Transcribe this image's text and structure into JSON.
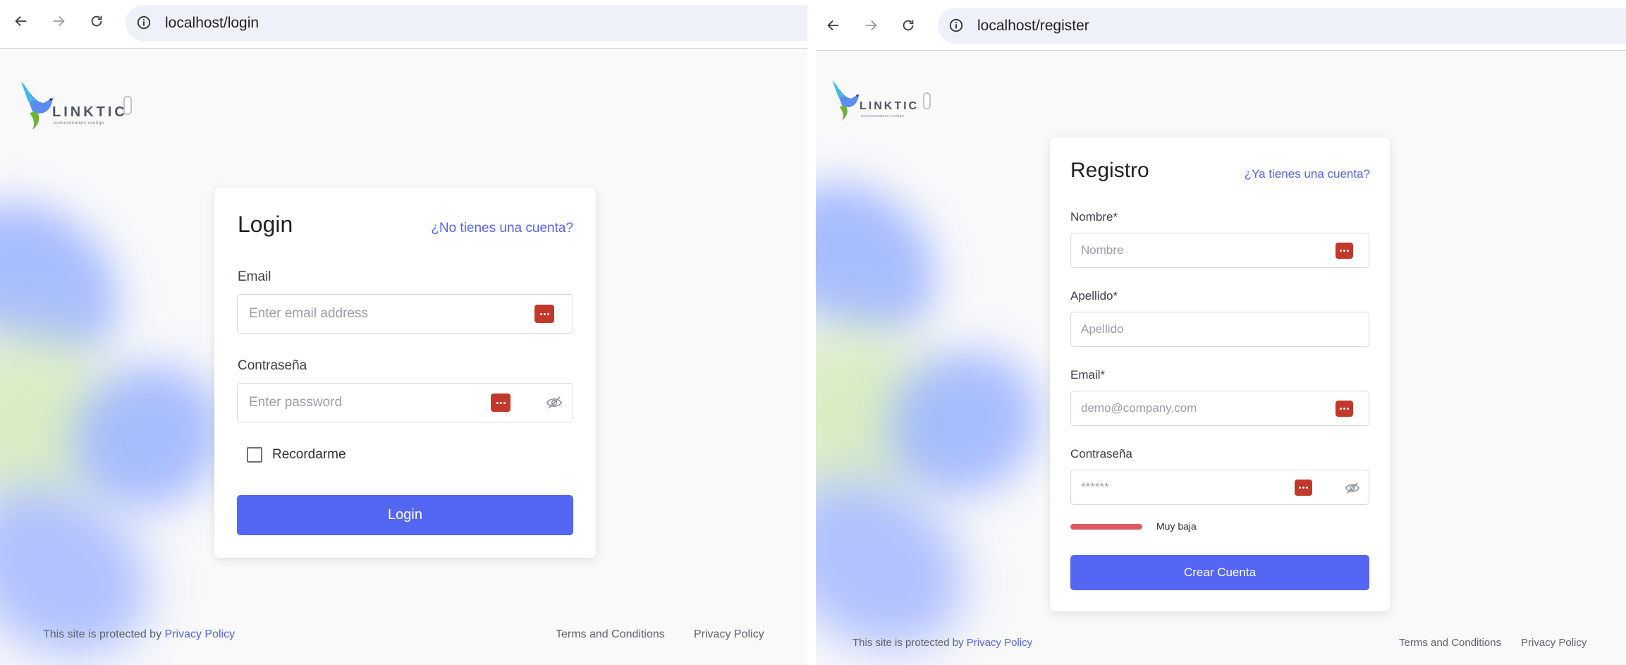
{
  "left": {
    "url": "localhost/login",
    "brand": {
      "name": "LINKTIC",
      "tagline": "evolucionamos contigo"
    },
    "card": {
      "title": "Login",
      "alt_link": "¿No tienes una cuenta?",
      "email_label": "Email",
      "email_placeholder": "Enter email address",
      "password_label": "Contraseña",
      "password_placeholder": "Enter password",
      "remember_label": "Recordarme",
      "submit_label": "Login"
    },
    "footer": {
      "protected_text": "This site is protected by",
      "protected_link": "Privacy Policy",
      "terms": "Terms and Conditions",
      "privacy": "Privacy Policy"
    }
  },
  "right": {
    "url": "localhost/register",
    "brand": {
      "name": "LINKTIC",
      "tagline": "evolucionamos contigo"
    },
    "card": {
      "title": "Registro",
      "alt_link": "¿Ya tienes una cuenta?",
      "name_label": "Nombre*",
      "name_placeholder": "Nombre",
      "lastname_label": "Apellido*",
      "lastname_placeholder": "Apellido",
      "email_label": "Email*",
      "email_placeholder": "demo@company.com",
      "password_label": "Contraseña",
      "password_placeholder": "******",
      "strength_label": "Muy baja",
      "strength_fraction": 1.0,
      "submit_label": "Crear Cuenta"
    },
    "footer": {
      "protected_text": "This site is protected by",
      "protected_link": "Privacy Policy",
      "terms": "Terms and Conditions",
      "privacy": "Privacy Policy"
    }
  },
  "icons": {
    "back": "arrow-left-icon",
    "forward": "arrow-right-icon",
    "reload": "reload-icon",
    "site_info": "info-icon",
    "password_manager": "password-manager-icon",
    "eye_off": "eye-off-icon"
  },
  "colors": {
    "primary": "#5466f4",
    "link": "#5664e8",
    "password_manager": "#c0392b",
    "strength_low": "#dd5961"
  }
}
